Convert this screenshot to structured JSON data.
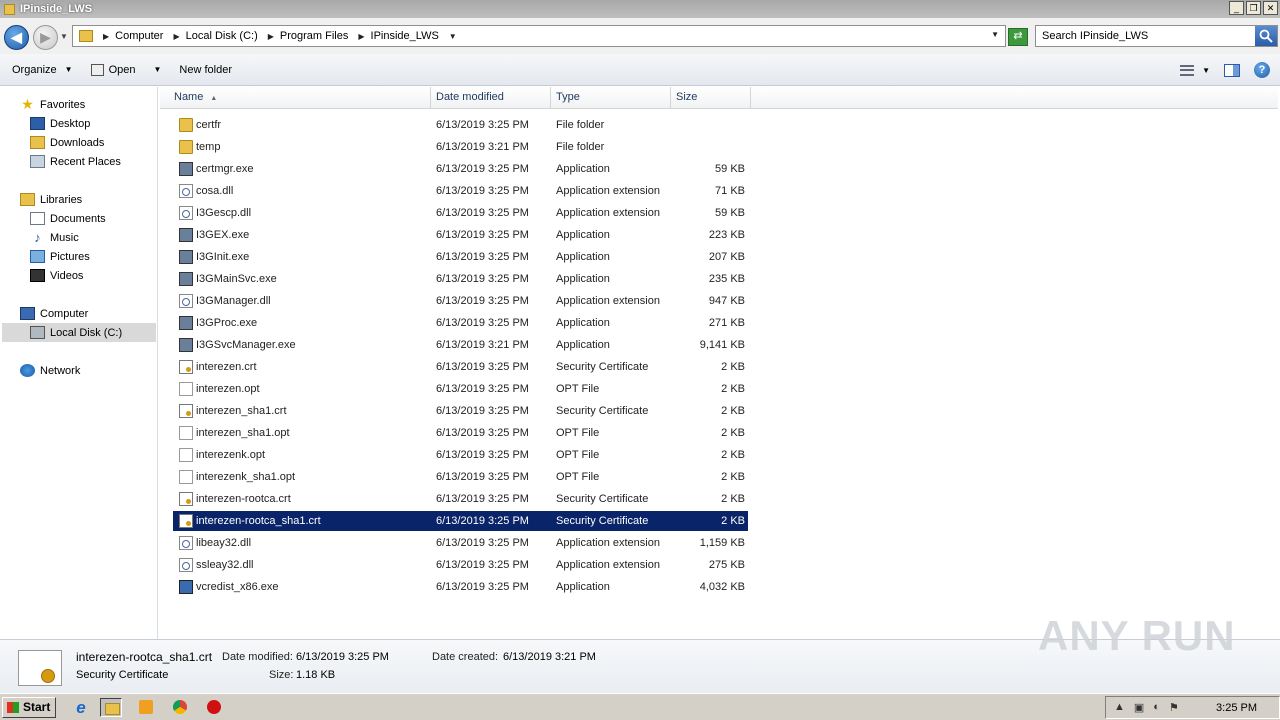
{
  "window": {
    "title": "IPinside_LWS",
    "controls": [
      "_",
      "❐",
      "✕"
    ]
  },
  "address": {
    "crumbs": [
      "Computer",
      "Local Disk (C:)",
      "Program Files",
      "IPinside_LWS"
    ],
    "search_placeholder": "Search IPinside_LWS"
  },
  "toolbar": {
    "organize": "Organize",
    "open": "Open",
    "new_folder": "New folder"
  },
  "nav": {
    "favorites": "Favorites",
    "desktop": "Desktop",
    "downloads": "Downloads",
    "recent": "Recent Places",
    "libraries": "Libraries",
    "documents": "Documents",
    "music": "Music",
    "pictures": "Pictures",
    "videos": "Videos",
    "computer": "Computer",
    "local_disk": "Local Disk (C:)",
    "network": "Network"
  },
  "columns": {
    "name": "Name",
    "date": "Date modified",
    "type": "Type",
    "size": "Size"
  },
  "files": [
    {
      "name": "certfr",
      "date": "6/13/2019 3:25 PM",
      "type": "File folder",
      "size": "",
      "icon": "folder-icon"
    },
    {
      "name": "temp",
      "date": "6/13/2019 3:21 PM",
      "type": "File folder",
      "size": "",
      "icon": "folder-icon"
    },
    {
      "name": "certmgr.exe",
      "date": "6/13/2019 3:25 PM",
      "type": "Application",
      "size": "59 KB",
      "icon": "app-icon"
    },
    {
      "name": "cosa.dll",
      "date": "6/13/2019 3:25 PM",
      "type": "Application extension",
      "size": "71 KB",
      "icon": "dll-icon"
    },
    {
      "name": "I3Gescp.dll",
      "date": "6/13/2019 3:25 PM",
      "type": "Application extension",
      "size": "59 KB",
      "icon": "dll-icon"
    },
    {
      "name": "I3GEX.exe",
      "date": "6/13/2019 3:25 PM",
      "type": "Application",
      "size": "223 KB",
      "icon": "app-icon"
    },
    {
      "name": "I3GInit.exe",
      "date": "6/13/2019 3:25 PM",
      "type": "Application",
      "size": "207 KB",
      "icon": "app-icon"
    },
    {
      "name": "I3GMainSvc.exe",
      "date": "6/13/2019 3:25 PM",
      "type": "Application",
      "size": "235 KB",
      "icon": "app-icon"
    },
    {
      "name": "I3GManager.dll",
      "date": "6/13/2019 3:25 PM",
      "type": "Application extension",
      "size": "947 KB",
      "icon": "dll-icon"
    },
    {
      "name": "I3GProc.exe",
      "date": "6/13/2019 3:25 PM",
      "type": "Application",
      "size": "271 KB",
      "icon": "app-icon"
    },
    {
      "name": "I3GSvcManager.exe",
      "date": "6/13/2019 3:21 PM",
      "type": "Application",
      "size": "9,141 KB",
      "icon": "app-icon"
    },
    {
      "name": "interezen.crt",
      "date": "6/13/2019 3:25 PM",
      "type": "Security Certificate",
      "size": "2 KB",
      "icon": "certificate-icon"
    },
    {
      "name": "interezen.opt",
      "date": "6/13/2019 3:25 PM",
      "type": "OPT File",
      "size": "2 KB",
      "icon": "file-icon"
    },
    {
      "name": "interezen_sha1.crt",
      "date": "6/13/2019 3:25 PM",
      "type": "Security Certificate",
      "size": "2 KB",
      "icon": "certificate-icon"
    },
    {
      "name": "interezen_sha1.opt",
      "date": "6/13/2019 3:25 PM",
      "type": "OPT File",
      "size": "2 KB",
      "icon": "file-icon"
    },
    {
      "name": "interezenk.opt",
      "date": "6/13/2019 3:25 PM",
      "type": "OPT File",
      "size": "2 KB",
      "icon": "file-icon"
    },
    {
      "name": "interezenk_sha1.opt",
      "date": "6/13/2019 3:25 PM",
      "type": "OPT File",
      "size": "2 KB",
      "icon": "file-icon"
    },
    {
      "name": "interezen-rootca.crt",
      "date": "6/13/2019 3:25 PM",
      "type": "Security Certificate",
      "size": "2 KB",
      "icon": "certificate-icon"
    },
    {
      "name": "interezen-rootca_sha1.crt",
      "date": "6/13/2019 3:25 PM",
      "type": "Security Certificate",
      "size": "2 KB",
      "icon": "certificate-icon",
      "selected": true
    },
    {
      "name": "libeay32.dll",
      "date": "6/13/2019 3:25 PM",
      "type": "Application extension",
      "size": "1,159 KB",
      "icon": "dll-icon"
    },
    {
      "name": "ssleay32.dll",
      "date": "6/13/2019 3:25 PM",
      "type": "Application extension",
      "size": "275 KB",
      "icon": "dll-icon"
    },
    {
      "name": "vcredist_x86.exe",
      "date": "6/13/2019 3:25 PM",
      "type": "Application",
      "size": "4,032 KB",
      "icon": "installer-icon"
    }
  ],
  "details": {
    "name": "interezen-rootca_sha1.crt",
    "type": "Security Certificate",
    "modified_label": "Date modified:",
    "modified": "6/13/2019 3:25 PM",
    "created_label": "Date created:",
    "created": "6/13/2019 3:21 PM",
    "size_label": "Size:",
    "size": "1.18 KB"
  },
  "watermark": "ANY RUN",
  "taskbar": {
    "start": "Start",
    "clock": "3:25 PM"
  },
  "colors": {
    "selection": "#0a246a",
    "header_text": "#1e395b"
  }
}
